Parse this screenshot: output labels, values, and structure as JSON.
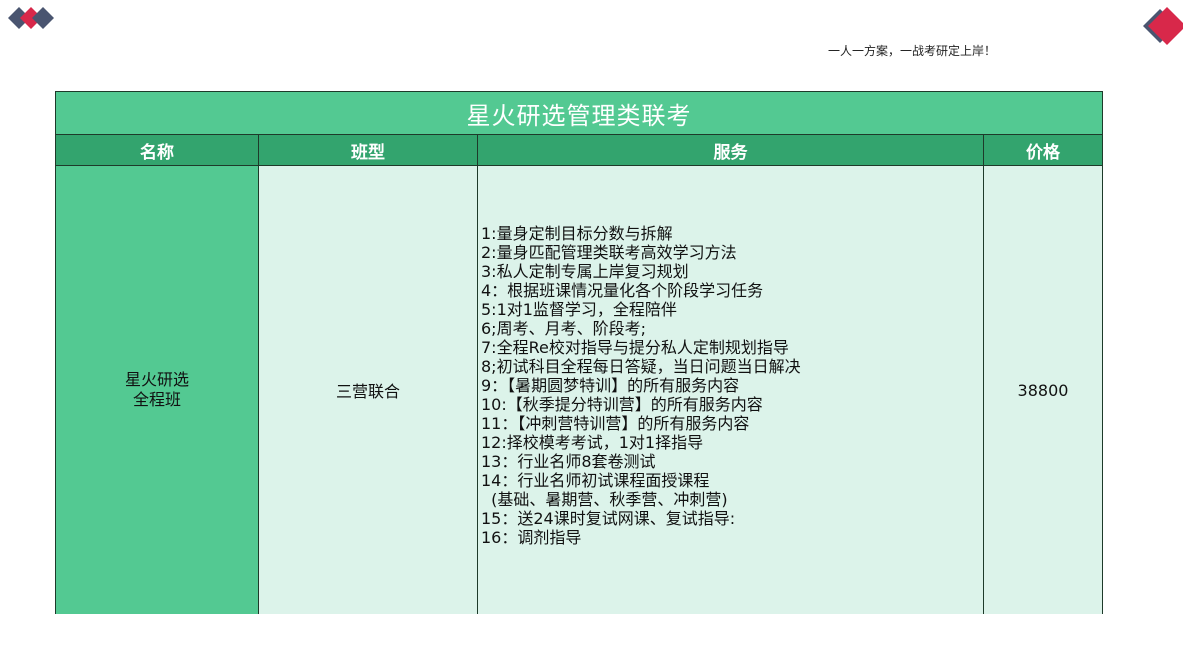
{
  "header": {
    "slogan": "一人一方案，一战考研定上岸！",
    "colors": {
      "logo_navy": "#4a5570",
      "logo_red": "#d8284a"
    }
  },
  "table": {
    "title": "星火研选管理类联考",
    "columns": [
      "名称",
      "班型",
      "服务",
      "价格"
    ],
    "row": {
      "name_line1": "星火研选",
      "name_line2": "全程班",
      "type": "三营联合",
      "services": [
        "1:量身定制目标分数与拆解",
        "2:量身匹配管理类联考高效学习方法",
        "3:私人定制专属上岸复习规划",
        "4：根据班课情况量化各个阶段学习任务",
        "5:1对1监督学习，全程陪伴",
        "6;周考、月考、阶段考;",
        "7:全程Re校对指导与提分私人定制规划指导",
        "8;初试科目全程每日答疑，当日问题当日解决",
        "9：【暑期圆梦特训】的所有服务内容",
        "10:【秋季提分特训营】的所有服务内容",
        "11：【冲刺营特训营】的所有服务内容",
        "12:择校模考考试，1对1择指导",
        "13：行业名师8套卷测试",
        "14：行业名师初试课程面授课程",
        "  (基础、暑期营、秋季营、冲刺营)",
        "15：送24课时复试网课、复试指导:",
        "16：调剂指导"
      ],
      "price": "38800"
    },
    "colors": {
      "title_bg": "#53c992",
      "header_bg": "#33a46e",
      "name_bg": "#53c992",
      "cell_bg": "#dcf3ea"
    }
  }
}
